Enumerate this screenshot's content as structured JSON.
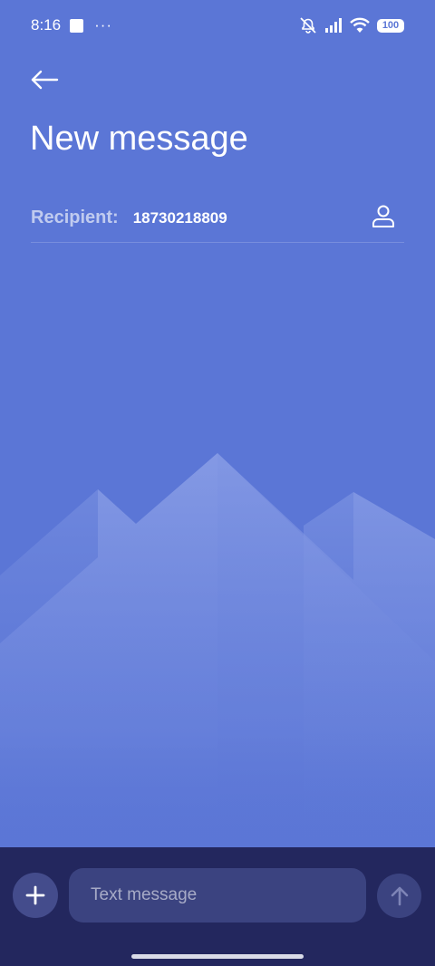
{
  "status_bar": {
    "time": "8:16",
    "dots": "···",
    "battery": "100",
    "icons": [
      "square-notification-icon",
      "mute-icon",
      "signal-icon",
      "wifi-icon",
      "battery-icon"
    ]
  },
  "header": {
    "title": "New message",
    "back_icon": "arrow-left-icon"
  },
  "recipient": {
    "label": "Recipient:",
    "value": "18730218809",
    "contact_icon": "person-icon"
  },
  "composer": {
    "placeholder": "Text message",
    "add_icon": "plus-icon",
    "send_icon": "arrow-up-icon"
  },
  "colors": {
    "background": "#5b76d6",
    "bottom_bar": "#23275e",
    "input": "#3b4380"
  }
}
